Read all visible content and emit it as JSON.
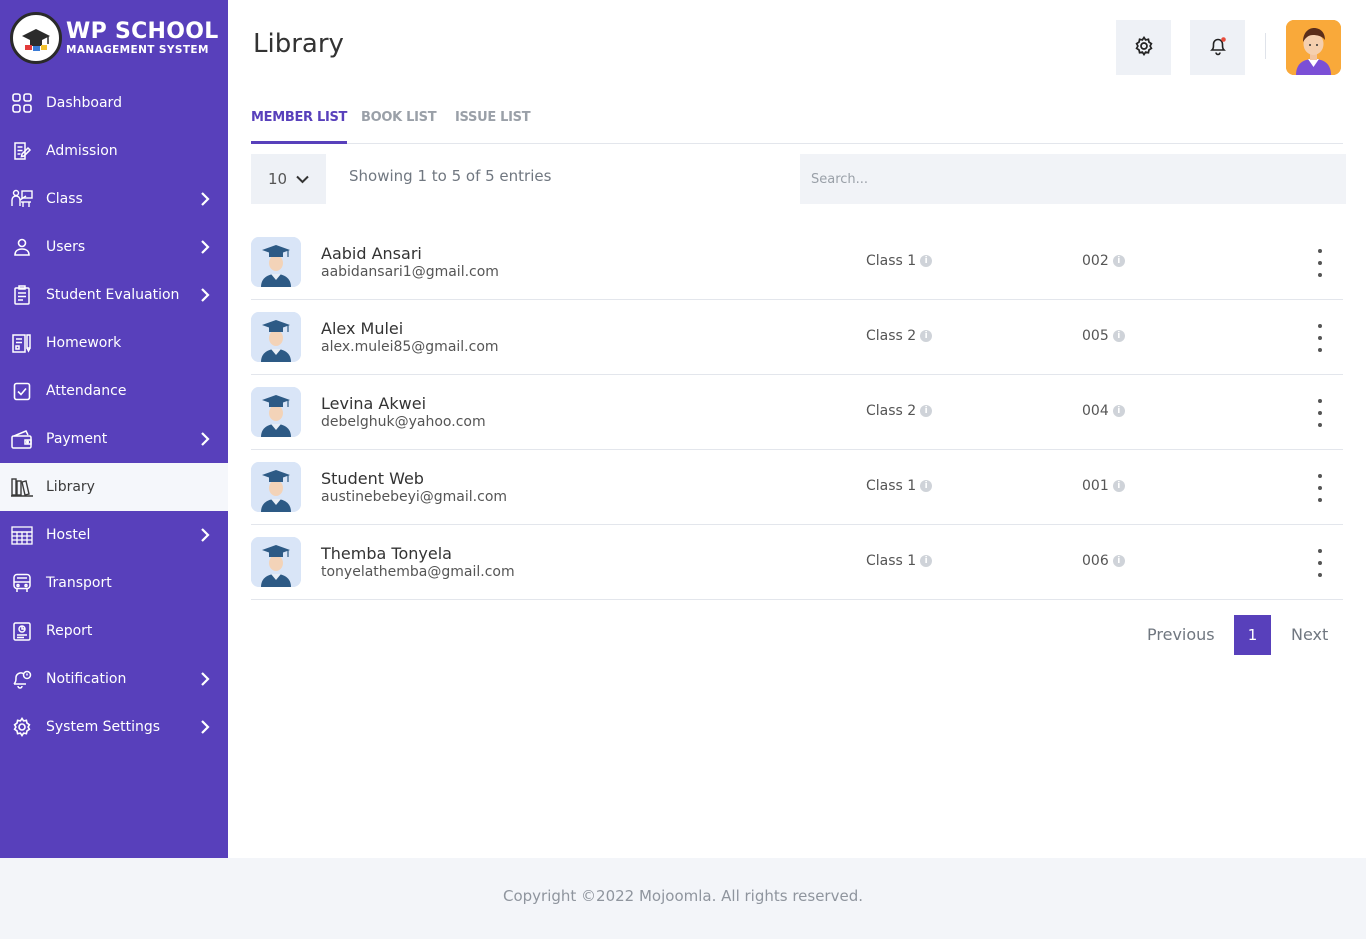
{
  "brand": {
    "title": "WP SCHOOL",
    "subtitle": "MANAGEMENT SYSTEM"
  },
  "sidebar": {
    "items": [
      {
        "label": "Dashboard",
        "icon": "dashboard-icon",
        "has_submenu": false
      },
      {
        "label": "Admission",
        "icon": "admission-icon",
        "has_submenu": false
      },
      {
        "label": "Class",
        "icon": "class-icon",
        "has_submenu": true
      },
      {
        "label": "Users",
        "icon": "user-icon",
        "has_submenu": true
      },
      {
        "label": "Student Evaluation",
        "icon": "evaluation-icon",
        "has_submenu": true
      },
      {
        "label": "Homework",
        "icon": "homework-icon",
        "has_submenu": false
      },
      {
        "label": "Attendance",
        "icon": "attendance-icon",
        "has_submenu": false
      },
      {
        "label": "Payment",
        "icon": "wallet-icon",
        "has_submenu": true
      },
      {
        "label": "Library",
        "icon": "library-icon",
        "has_submenu": false,
        "active": true
      },
      {
        "label": "Hostel",
        "icon": "hostel-icon",
        "has_submenu": true
      },
      {
        "label": "Transport",
        "icon": "bus-icon",
        "has_submenu": false
      },
      {
        "label": "Report",
        "icon": "report-icon",
        "has_submenu": false
      },
      {
        "label": "Notification",
        "icon": "notification-icon",
        "has_submenu": true
      },
      {
        "label": "System Settings",
        "icon": "gear-icon",
        "has_submenu": true
      }
    ]
  },
  "header": {
    "title": "Library"
  },
  "tabs": [
    {
      "label": "MEMBER LIST",
      "active": true
    },
    {
      "label": "BOOK LIST",
      "active": false
    },
    {
      "label": "ISSUE LIST",
      "active": false
    }
  ],
  "table": {
    "page_length": "10",
    "info": "Showing 1 to 5 of 5 entries",
    "search_placeholder": "Search...",
    "rows": [
      {
        "name": "Aabid Ansari",
        "email": "aabidansari1@gmail.com",
        "class": "Class 1",
        "roll": "002"
      },
      {
        "name": "Alex Mulei",
        "email": "alex.mulei85@gmail.com",
        "class": "Class 2",
        "roll": "005"
      },
      {
        "name": "Levina Akwei",
        "email": "debelghuk@yahoo.com",
        "class": "Class 2",
        "roll": "004"
      },
      {
        "name": "Student Web",
        "email": "austinebebeyi@gmail.com",
        "class": "Class 1",
        "roll": "001"
      },
      {
        "name": "Themba Tonyela",
        "email": "tonyelathemba@gmail.com",
        "class": "Class 1",
        "roll": "006"
      }
    ]
  },
  "pagination": {
    "previous": "Previous",
    "current": "1",
    "next": "Next"
  },
  "footer": {
    "text": "Copyright ©2022 Mojoomla. All rights reserved."
  },
  "colors": {
    "primary": "#5840bb",
    "notification_dot": "#e74c3c",
    "avatar_bg": "#f9a93a"
  }
}
